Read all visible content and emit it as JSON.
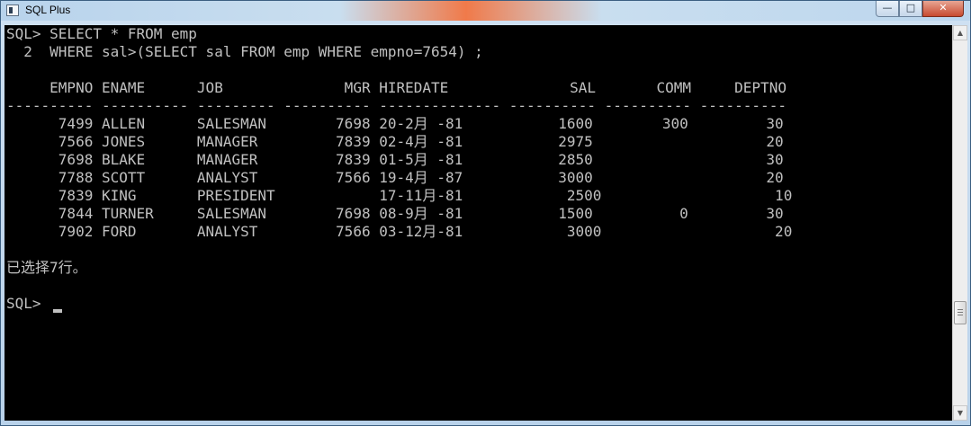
{
  "window": {
    "title": "SQL Plus",
    "minimize_glyph": "—",
    "maximize_glyph": "□",
    "close_glyph": "✕"
  },
  "console": {
    "lines": [
      "SQL> SELECT * FROM emp",
      "  2  WHERE sal>(SELECT sal FROM emp WHERE empno=7654) ;",
      "",
      "     EMPNO ENAME      JOB              MGR HIREDATE              SAL       COMM     DEPTNO",
      "---------- ---------- --------- ---------- -------------- ---------- ---------- ----------",
      "      7499 ALLEN      SALESMAN        7698 20-2月 -81           1600        300         30",
      "      7566 JONES      MANAGER         7839 02-4月 -81           2975                    20",
      "      7698 BLAKE      MANAGER         7839 01-5月 -81           2850                    30",
      "      7788 SCOTT      ANALYST         7566 19-4月 -87           3000                    20",
      "      7839 KING       PRESIDENT            17-11月-81            2500                    10",
      "      7844 TURNER     SALESMAN        7698 08-9月 -81           1500          0         30",
      "      7902 FORD       ANALYST         7566 03-12月-81            3000                    20",
      "",
      "已选择7行。",
      "",
      "SQL> "
    ]
  },
  "scrollbar": {
    "up_glyph": "▲",
    "down_glyph": "▼"
  }
}
